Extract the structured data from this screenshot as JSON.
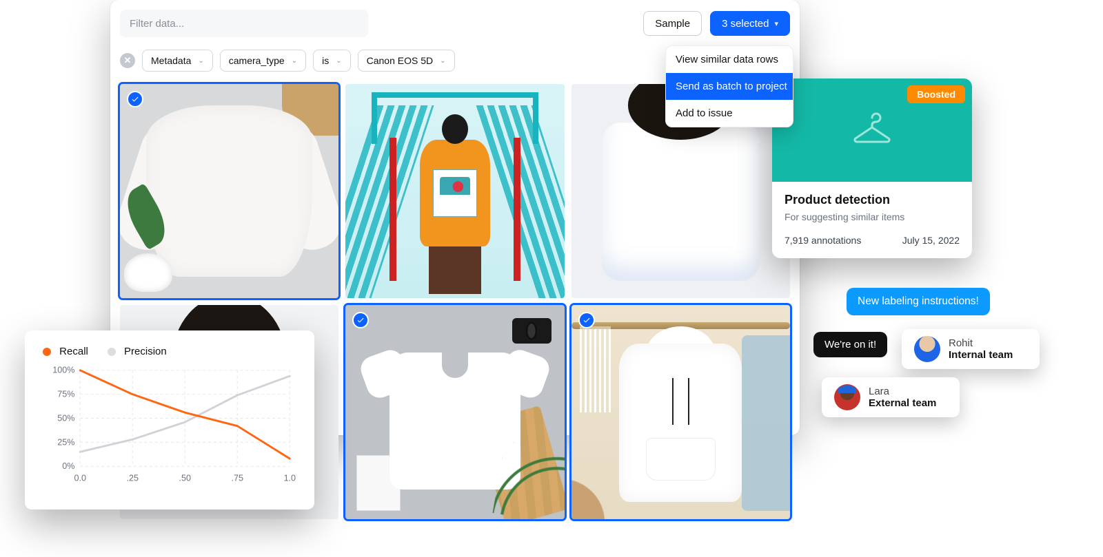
{
  "filter_placeholder": "Filter data...",
  "toolbar": {
    "sample": "Sample",
    "selected": "3 selected"
  },
  "chips": {
    "metadata": "Metadata",
    "field": "camera_type",
    "operator": "is",
    "value": "Canon EOS 5D"
  },
  "menu": {
    "view_similar": "View similar data rows",
    "send_batch": "Send as batch to project",
    "add_issue": "Add to issue"
  },
  "dataset": {
    "boost": "Boosted",
    "title": "Product detection",
    "subtitle": "For suggesting similar items",
    "annotations": "7,919 annotations",
    "date": "July 15, 2022"
  },
  "chat": {
    "instructions": "New labeling instructions!",
    "reply": "We're on it!",
    "p1_name": "Rohit",
    "p1_role": "Internal team",
    "p2_name": "Lara",
    "p2_role": "External team"
  },
  "legend": {
    "recall": "Recall",
    "precision": "Precision"
  },
  "chart_data": {
    "type": "line",
    "x": [
      0.0,
      0.25,
      0.5,
      0.75,
      1.0
    ],
    "xlabels": [
      "0.0",
      ".25",
      ".50",
      ".75",
      "1.0"
    ],
    "ylabels": [
      "0%",
      "25%",
      "50%",
      "75%",
      "100%"
    ],
    "y_recall": [
      100,
      75,
      56,
      42,
      8
    ],
    "y_precision": [
      15,
      28,
      46,
      74,
      94
    ],
    "ylim": [
      0,
      100
    ],
    "colors": {
      "recall": "#ff6612",
      "precision": "#cfd3d8"
    },
    "title": "",
    "xlabel": "",
    "ylabel": ""
  }
}
